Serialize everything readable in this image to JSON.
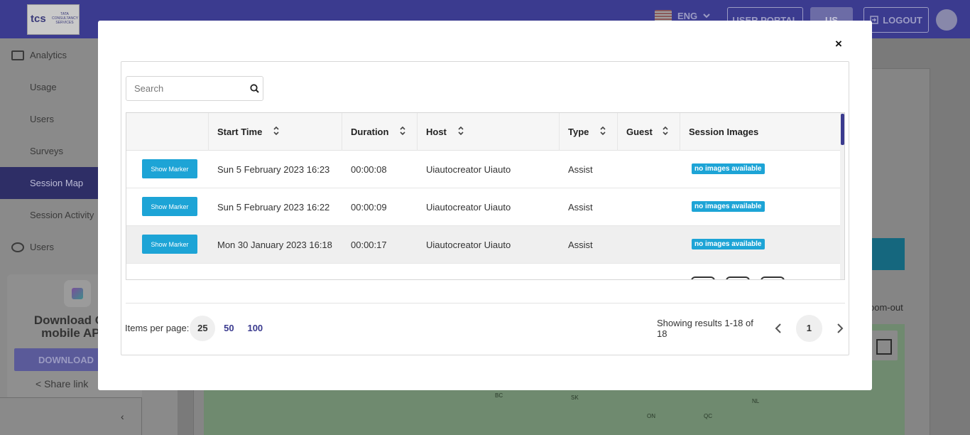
{
  "background": {
    "logo": {
      "brand": "tcs",
      "sub": "TATA CONSULTANCY SERVICES"
    },
    "topbar": {
      "language": "ENG",
      "user_portal": "USER PORTAL",
      "region": "US",
      "logout": "LOGOUT"
    },
    "sidebar": {
      "items": [
        {
          "label": "Analytics"
        },
        {
          "label": "Usage"
        },
        {
          "label": "Users"
        },
        {
          "label": "Surveys"
        },
        {
          "label": "Session Map"
        },
        {
          "label": "Session Activity"
        },
        {
          "label": "Users"
        }
      ],
      "promo": {
        "title_line1": "Download Car",
        "title_line2": "mobile APP",
        "button": "DOWNLOAD",
        "share": "Share link"
      }
    },
    "main": {
      "zoom_text": "oom-out"
    },
    "map": {
      "labels": [
        "BC",
        "SK",
        "ON",
        "QC",
        "NL"
      ]
    }
  },
  "modal": {
    "close_icon": "×",
    "search": {
      "placeholder": "Search",
      "value": ""
    },
    "table": {
      "columns": [
        "",
        "Start Time",
        "Duration",
        "Host",
        "Type",
        "Guest",
        "Session Images"
      ],
      "rows": [
        {
          "action": "Show Marker",
          "start_time": "Sun 5 February 2023 16:23",
          "duration": "00:00:08",
          "host": "Uiautocreator Uiauto",
          "type": "Assist",
          "guest": "",
          "images": "no images available"
        },
        {
          "action": "Show Marker",
          "start_time": "Sun 5 February 2023 16:22",
          "duration": "00:00:09",
          "host": "Uiautocreator Uiauto",
          "type": "Assist",
          "guest": "",
          "images": "no images available"
        },
        {
          "action": "Show Marker",
          "start_time": "Mon 30 January 2023 16:18",
          "duration": "00:00:17",
          "host": "Uiautocreator Uiauto",
          "type": "Assist",
          "guest": "",
          "images": "no images available"
        }
      ]
    },
    "pagination": {
      "items_per_page_label": "Items per page:",
      "options": [
        "25",
        "50",
        "100"
      ],
      "selected": "25",
      "results_text": "Showing results 1-18 of 18",
      "current_page": "1"
    }
  },
  "colors": {
    "accent": "#3b3b8f",
    "button": "#1da4d6",
    "badge": "#1da4d6"
  }
}
